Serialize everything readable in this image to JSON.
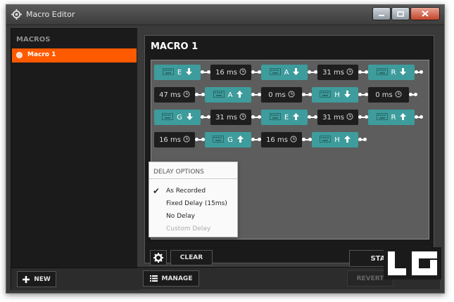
{
  "window": {
    "title": "Macro Editor"
  },
  "sidebar": {
    "title": "MACROS",
    "items": [
      {
        "label": "Macro 1",
        "selected": true
      }
    ],
    "new_label": "NEW"
  },
  "panel": {
    "title": "MACRO 1",
    "rows": [
      [
        {
          "kind": "key",
          "label": "E",
          "dir": "down"
        },
        {
          "kind": "delay",
          "label": "16 ms"
        },
        {
          "kind": "key",
          "label": "A",
          "dir": "down"
        },
        {
          "kind": "delay",
          "label": "31 ms"
        },
        {
          "kind": "key",
          "label": "R",
          "dir": "down"
        }
      ],
      [
        {
          "kind": "delay",
          "label": "47 ms"
        },
        {
          "kind": "key",
          "label": "A",
          "dir": "up"
        },
        {
          "kind": "delay",
          "label": "0 ms"
        },
        {
          "kind": "key",
          "label": "H",
          "dir": "down"
        },
        {
          "kind": "delay",
          "label": "0 ms"
        }
      ],
      [
        {
          "kind": "key",
          "label": "G",
          "dir": "down"
        },
        {
          "kind": "delay",
          "label": "31 ms"
        },
        {
          "kind": "key",
          "label": "E",
          "dir": "up"
        },
        {
          "kind": "delay",
          "label": "31 ms"
        },
        {
          "kind": "key",
          "label": "R",
          "dir": "up"
        }
      ],
      [
        {
          "kind": "delay",
          "label": "16 ms"
        },
        {
          "kind": "key",
          "label": "G",
          "dir": "up"
        },
        {
          "kind": "delay",
          "label": "16 ms"
        },
        {
          "kind": "key",
          "label": "H",
          "dir": "up"
        }
      ]
    ],
    "clear_label": "CLEAR",
    "start_label": "START"
  },
  "delay_options": {
    "title": "DELAY OPTIONS",
    "items": [
      {
        "label": "As Recorded",
        "checked": true,
        "disabled": false
      },
      {
        "label": "Fixed Delay (15ms)",
        "checked": false,
        "disabled": false
      },
      {
        "label": "No Delay",
        "checked": false,
        "disabled": false
      },
      {
        "label": "Custom Delay",
        "checked": false,
        "disabled": true
      }
    ]
  },
  "footer": {
    "manage_label": "MANAGE",
    "revert_label": "REVERT"
  },
  "colors": {
    "accent": "#ff5a00",
    "key_block": "#3e9c9c",
    "delay_block": "#1e1e1e"
  },
  "icons": {
    "key": "keyboard-icon",
    "delay": "clock-icon",
    "down": "arrow-down-icon",
    "up": "arrow-up-icon"
  }
}
